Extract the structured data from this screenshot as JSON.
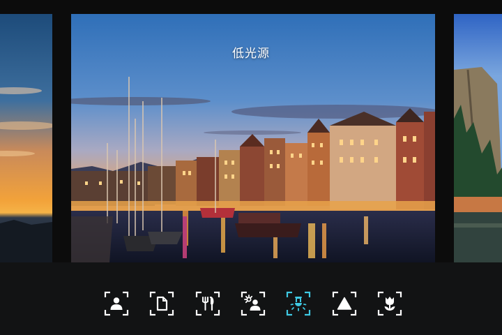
{
  "current_mode": {
    "title": "低光源"
  },
  "colors": {
    "accent": "#3fc9e3",
    "icon_default": "#ffffff",
    "toolbar_bg": "#121314",
    "screen_bg": "#0c0c0c"
  },
  "modes": [
    {
      "icon": "portrait-icon",
      "selected": false
    },
    {
      "icon": "document-icon",
      "selected": false
    },
    {
      "icon": "food-icon",
      "selected": false
    },
    {
      "icon": "backlight-portrait-icon",
      "selected": false
    },
    {
      "icon": "low-light-icon",
      "selected": true
    },
    {
      "icon": "landscape-icon",
      "selected": false
    },
    {
      "icon": "flower-icon",
      "selected": false
    }
  ]
}
